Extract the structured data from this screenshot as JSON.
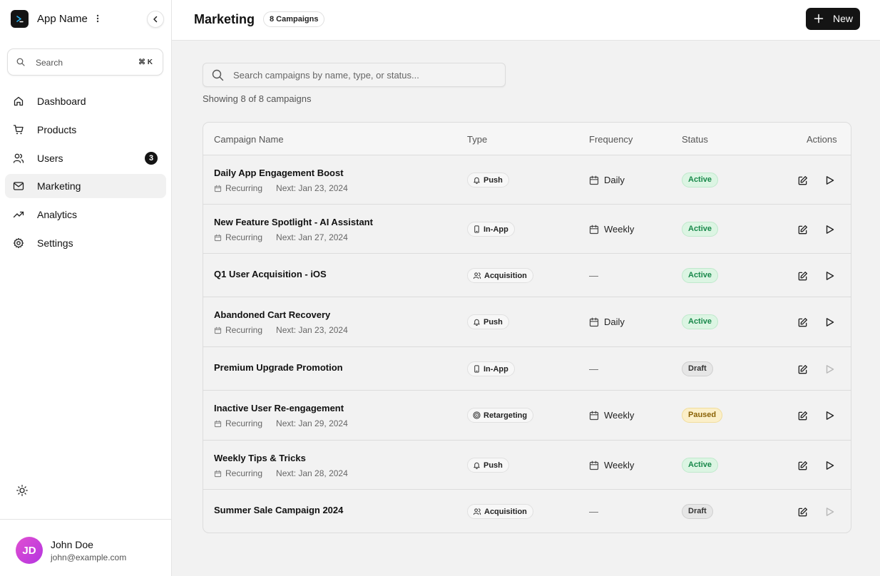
{
  "app": {
    "name": "App Name"
  },
  "search": {
    "label": "Search",
    "shortcut": "⌘ K"
  },
  "nav": [
    {
      "id": "dashboard",
      "label": "Dashboard",
      "icon": "home-icon",
      "active": false
    },
    {
      "id": "products",
      "label": "Products",
      "icon": "cart-icon",
      "active": false
    },
    {
      "id": "users",
      "label": "Users",
      "icon": "users-icon",
      "active": false,
      "badge": "3"
    },
    {
      "id": "marketing",
      "label": "Marketing",
      "icon": "mail-icon",
      "active": true
    },
    {
      "id": "analytics",
      "label": "Analytics",
      "icon": "trending-up-icon",
      "active": false
    },
    {
      "id": "settings",
      "label": "Settings",
      "icon": "gear-icon",
      "active": false
    }
  ],
  "user": {
    "initials": "JD",
    "name": "John Doe",
    "email": "john@example.com"
  },
  "header": {
    "title": "Marketing",
    "count_badge": "8 Campaigns",
    "new_label": "New"
  },
  "campaign_search": {
    "placeholder": "Search campaigns by name, type, or status..."
  },
  "showing_text": "Showing 8 of 8 campaigns",
  "table": {
    "columns": [
      "Campaign Name",
      "Type",
      "Frequency",
      "Status",
      "Actions"
    ],
    "rows": [
      {
        "name": "Daily App Engagement Boost",
        "recurring": "Recurring",
        "next": "Next: Jan 23, 2024",
        "type": "Push",
        "type_icon": "bell-icon",
        "frequency": "Daily",
        "status": "Active",
        "play_enabled": true
      },
      {
        "name": "New Feature Spotlight - AI Assistant",
        "recurring": "Recurring",
        "next": "Next: Jan 27, 2024",
        "type": "In-App",
        "type_icon": "smartphone-icon",
        "frequency": "Weekly",
        "status": "Active",
        "play_enabled": true
      },
      {
        "name": "Q1 User Acquisition - iOS",
        "type": "Acquisition",
        "type_icon": "users-icon",
        "frequency": "—",
        "status": "Active",
        "play_enabled": true
      },
      {
        "name": "Abandoned Cart Recovery",
        "recurring": "Recurring",
        "next": "Next: Jan 23, 2024",
        "type": "Push",
        "type_icon": "bell-icon",
        "frequency": "Daily",
        "status": "Active",
        "play_enabled": true
      },
      {
        "name": "Premium Upgrade Promotion",
        "type": "In-App",
        "type_icon": "smartphone-icon",
        "frequency": "—",
        "status": "Draft",
        "play_enabled": false
      },
      {
        "name": "Inactive User Re-engagement",
        "recurring": "Recurring",
        "next": "Next: Jan 29, 2024",
        "type": "Retargeting",
        "type_icon": "target-icon",
        "frequency": "Weekly",
        "status": "Paused",
        "play_enabled": true
      },
      {
        "name": "Weekly Tips & Tricks",
        "recurring": "Recurring",
        "next": "Next: Jan 28, 2024",
        "type": "Push",
        "type_icon": "bell-icon",
        "frequency": "Weekly",
        "status": "Active",
        "play_enabled": true
      },
      {
        "name": "Summer Sale Campaign 2024",
        "type": "Acquisition",
        "type_icon": "users-icon",
        "frequency": "—",
        "status": "Draft",
        "play_enabled": false
      }
    ]
  },
  "colors": {
    "accent": "#141414",
    "active_bg": "#dcf5e3",
    "active_text": "#18884a",
    "paused_bg": "#fbefc9",
    "paused_text": "#8a6206",
    "draft_bg": "#e6e6e6",
    "avatar_gradient_start": "#e14fd1",
    "avatar_gradient_end": "#b435e0"
  }
}
